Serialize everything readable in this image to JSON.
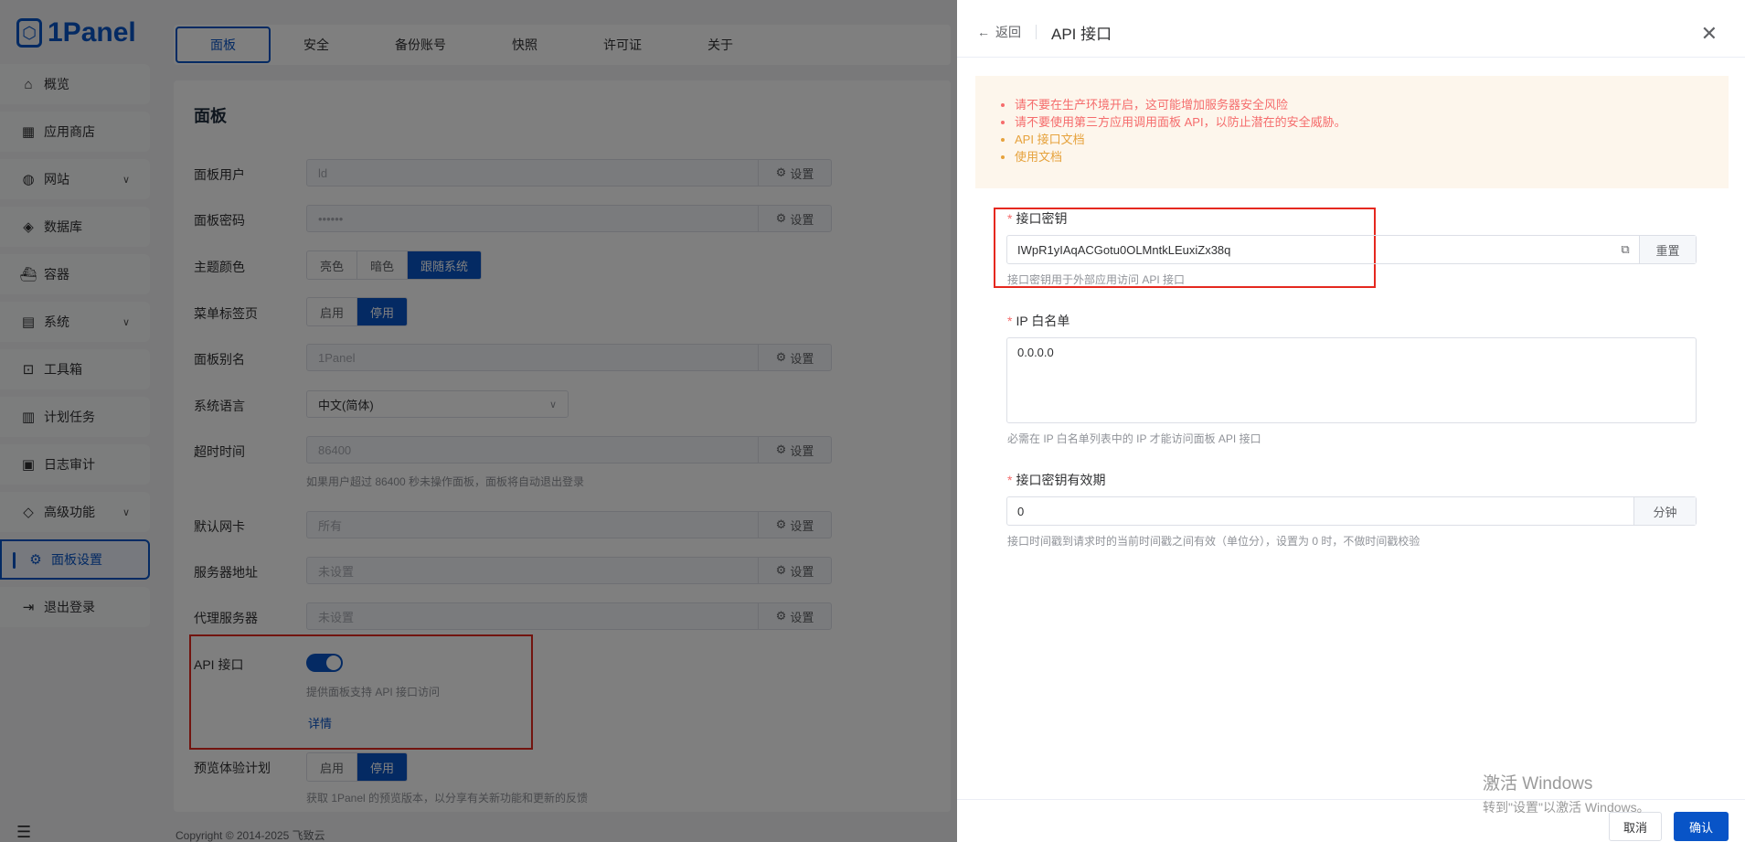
{
  "app": {
    "logo": "1Panel"
  },
  "sidebar": {
    "items": [
      {
        "label": "概览",
        "icon": "home-icon"
      },
      {
        "label": "应用商店",
        "icon": "grid-icon"
      },
      {
        "label": "网站",
        "icon": "globe-icon"
      },
      {
        "label": "数据库",
        "icon": "layers-icon"
      },
      {
        "label": "容器",
        "icon": "docker-icon"
      },
      {
        "label": "系统",
        "icon": "server-icon"
      },
      {
        "label": "工具箱",
        "icon": "toolbox-icon"
      },
      {
        "label": "计划任务",
        "icon": "calendar-icon"
      },
      {
        "label": "日志审计",
        "icon": "log-icon"
      },
      {
        "label": "高级功能",
        "icon": "diamond-icon"
      },
      {
        "label": "面板设置",
        "icon": "gear-icon"
      },
      {
        "label": "退出登录",
        "icon": "logout-icon"
      }
    ]
  },
  "tabs": [
    "面板",
    "安全",
    "备份账号",
    "快照",
    "许可证",
    "关于"
  ],
  "panel": {
    "title": "面板",
    "set_label": "设置",
    "user_label": "面板用户",
    "user_value": "ld",
    "password_label": "面板密码",
    "password_value": "••••••",
    "theme_label": "主题颜色",
    "theme_options": [
      "亮色",
      "暗色",
      "跟随系统"
    ],
    "menu_tabs_label": "菜单标签页",
    "menu_tabs_options": [
      "启用",
      "停用"
    ],
    "alias_label": "面板别名",
    "alias_value": "1Panel",
    "language_label": "系统语言",
    "language_value": "中文(简体)",
    "timeout_label": "超时时间",
    "timeout_value": "86400",
    "timeout_hint": "如果用户超过 86400 秒未操作面板，面板将自动退出登录",
    "nic_label": "默认网卡",
    "nic_value": "所有",
    "server_addr_label": "服务器地址",
    "server_addr_value": "未设置",
    "proxy_label": "代理服务器",
    "proxy_value": "未设置",
    "api_label": "API 接口",
    "api_hint": "提供面板支持 API 接口访问",
    "api_detail": "详情",
    "preview_label": "预览体验计划",
    "preview_options": [
      "启用",
      "停用"
    ],
    "preview_hint": "获取 1Panel 的预览版本，以分享有关新功能和更新的反馈"
  },
  "footer": {
    "copyright": "Copyright © 2014-2025 飞致云"
  },
  "drawer": {
    "back": "返回",
    "title": "API 接口",
    "alerts": [
      "请不要在生产环境开启，这可能增加服务器安全风险",
      "请不要使用第三方应用调用面板 API，以防止潜在的安全威胁。",
      "API 接口文档",
      "使用文档"
    ],
    "key_label": "接口密钥",
    "key_value": "IWpR1yIAqACGotu0OLMntkLEuxiZx38q",
    "key_reset": "重置",
    "key_hint": "接口密钥用于外部应用访问 API 接口",
    "ip_label": "IP 白名单",
    "ip_value": "0.0.0.0",
    "ip_hint": "必需在 IP 白名单列表中的 IP 才能访问面板 API 接口",
    "expiry_label": "接口密钥有效期",
    "expiry_value": "0",
    "expiry_unit": "分钟",
    "expiry_hint": "接口时间戳到请求时的当前时间戳之间有效（单位分），设置为 0 时，不做时间戳校验",
    "cancel": "取消",
    "confirm": "确认"
  },
  "watermark": {
    "line1": "激活 Windows",
    "line2": "转到\"设置\"以激活 Windows。"
  },
  "colors": {
    "accent": "#0854c7",
    "danger": "#e5281f",
    "alert_bg": "#fdf6ec"
  }
}
